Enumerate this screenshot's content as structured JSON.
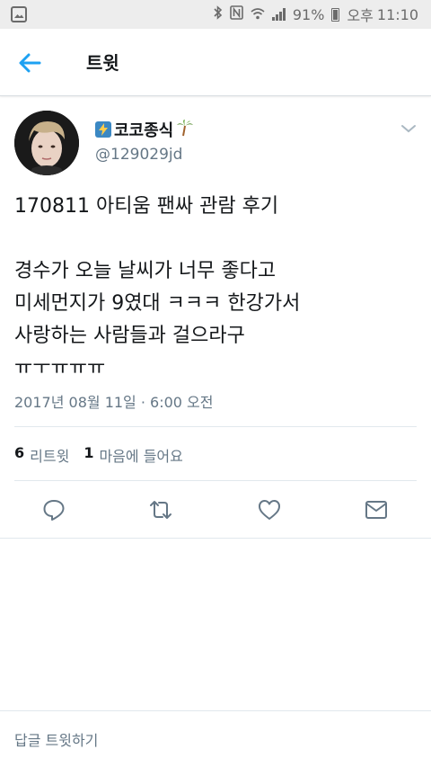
{
  "status_bar": {
    "battery": "91%",
    "ampm": "오후",
    "time": "11:10"
  },
  "header": {
    "title": "트윗"
  },
  "tweet": {
    "display_name": "코코종식",
    "username": "@129029jd",
    "text_lines": [
      "170811 아티움 팬싸 관람 후기",
      "",
      "경수가 오늘 날씨가 너무 좋다고",
      "미세먼지가 9였대 ㅋㅋㅋ 한강가서",
      "사랑하는 사람들과 걸으라구",
      "ㅠㅜㅠㅠㅠ"
    ],
    "timestamp": "2017년 08월 11일 · 6:00 오전"
  },
  "stats": {
    "retweets_count": "6",
    "retweets_label": "리트윗",
    "likes_count": "1",
    "likes_label": "마음에 들어요"
  },
  "reply": {
    "placeholder": "답글 트윗하기"
  },
  "colors": {
    "accent": "#1da1f2",
    "text_secondary": "#657786",
    "action_icon": "#657786"
  }
}
